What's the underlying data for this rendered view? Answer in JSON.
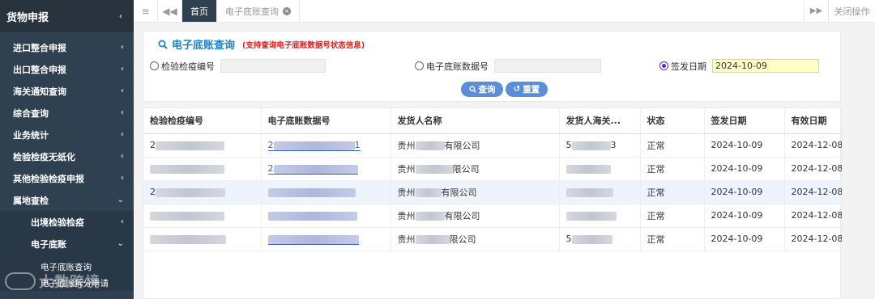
{
  "sidebar": {
    "title": "货物申报",
    "items": [
      {
        "label": "进口整合申报"
      },
      {
        "label": "出口整合申报"
      },
      {
        "label": "海关通知查询"
      },
      {
        "label": "综合查询"
      },
      {
        "label": "业务统计"
      },
      {
        "label": "检验检疫无纸化"
      },
      {
        "label": "其他检验检疫申报"
      },
      {
        "label": "属地查检"
      }
    ],
    "sub_items": [
      {
        "label": "出境检验检疫"
      },
      {
        "label": "电子底账"
      }
    ],
    "leaf_items": [
      {
        "label": "电子底账查询"
      },
      {
        "label": "电子底账拆分申请"
      }
    ],
    "watermark": "大数跨境"
  },
  "tabs": {
    "home": "首页",
    "current": "电子底账查询",
    "close_ops": "关闭操作"
  },
  "search": {
    "title": "电子底账查询",
    "note": "(支持查询电子底账数据号状态信息)",
    "field1_label": "检验检疫编号",
    "field1_value": "",
    "field2_label": "电子底账数据号",
    "field2_value": "",
    "field3_label": "签发日期",
    "field3_value": "2024-10-09",
    "query_btn": "查询",
    "reset_btn": "重置"
  },
  "table": {
    "columns": [
      "检验检疫编号",
      "电子底账数据号",
      "发货人名称",
      "发货人海关...",
      "状态",
      "签发日期",
      "有效日期"
    ],
    "rows": [
      {
        "c1": "2",
        "c2": "2",
        "c2_tail": "1",
        "c3": "贵州",
        "c3_tail": "有限公司",
        "c4": "5",
        "c4_tail": "3",
        "status": "正常",
        "issue": "2024-10-09",
        "valid": "2024-12-08"
      },
      {
        "c1": "",
        "c2": "2",
        "c2_tail": "",
        "c3": "贵州",
        "c3_tail": "限公司",
        "c4": "",
        "c4_tail": "",
        "status": "正常",
        "issue": "2024-10-09",
        "valid": "2024-12-08"
      },
      {
        "c1": "2",
        "c2": "",
        "c2_tail": "",
        "c3": "贵州",
        "c3_tail": "有限公司",
        "c4": "",
        "c4_tail": "",
        "status": "正常",
        "issue": "2024-10-09",
        "valid": "2024-12-08"
      },
      {
        "c1": "",
        "c2": "",
        "c2_tail": "",
        "c3": "贵州",
        "c3_tail": "有限公司",
        "c4": "",
        "c4_tail": "",
        "status": "正常",
        "issue": "2024-10-09",
        "valid": "2024-12-08"
      },
      {
        "c1": "",
        "c2": "",
        "c2_tail": "",
        "c3": "贵州",
        "c3_tail": "限公司",
        "c4": "5",
        "c4_tail": "",
        "status": "正常",
        "issue": "2024-10-09",
        "valid": "2024-12-08"
      }
    ]
  }
}
